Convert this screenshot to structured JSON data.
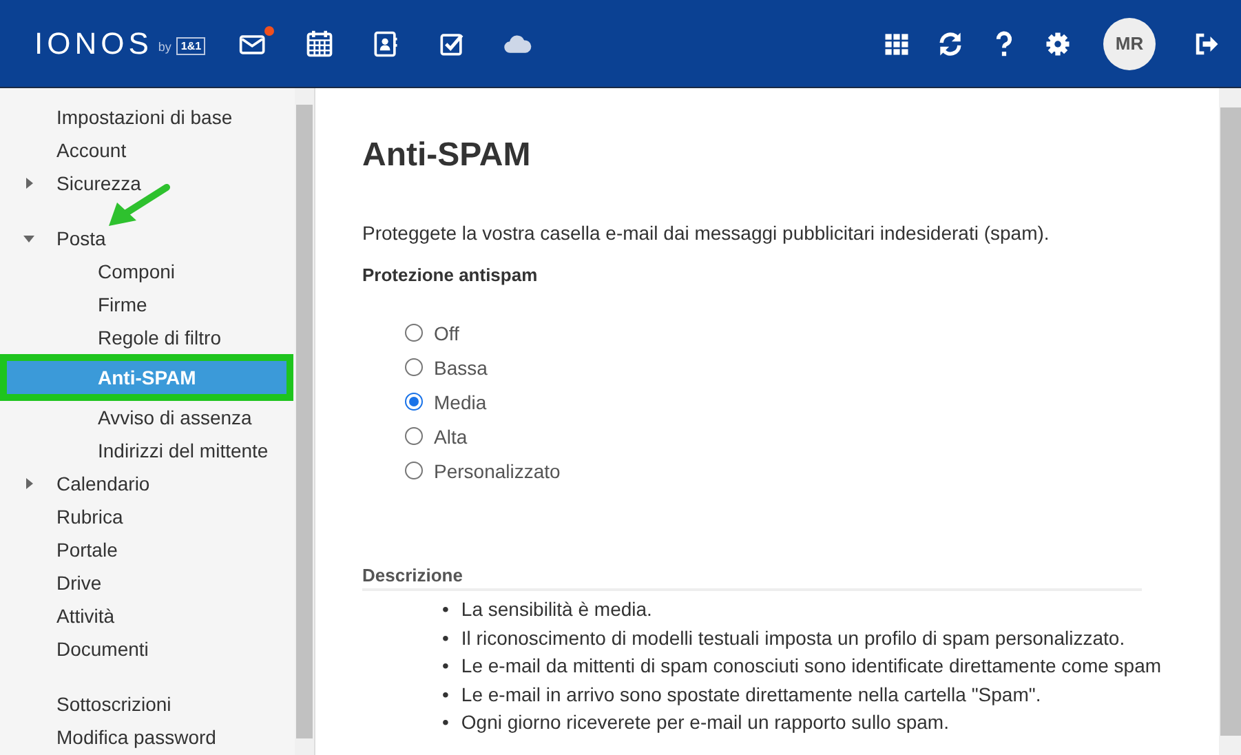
{
  "header": {
    "logo": "IONOS",
    "logo_by": "by",
    "logo_brand": "1&1",
    "apps": [
      {
        "kind": "mail",
        "badge": true
      },
      {
        "kind": "calendar",
        "badge": false
      },
      {
        "kind": "contacts",
        "badge": false
      },
      {
        "kind": "tasks",
        "badge": false
      },
      {
        "kind": "cloud",
        "badge": false
      }
    ],
    "tools": [
      {
        "kind": "apps"
      },
      {
        "kind": "refresh"
      },
      {
        "kind": "help"
      },
      {
        "kind": "settings"
      }
    ],
    "avatar": "MR"
  },
  "sidebar": {
    "pointer_arrow": true,
    "groups": [
      {
        "items": [
          {
            "label": "Impostazioni di base",
            "selected": false,
            "highlighted": false
          },
          {
            "label": "Account",
            "selected": false,
            "highlighted": false
          },
          {
            "label": "Sicurezza",
            "selected": false,
            "highlighted": false,
            "expanded": false
          }
        ]
      },
      {
        "items": [
          {
            "label": "Posta",
            "selected": false,
            "highlighted": false,
            "expanded": true,
            "children": [
              {
                "label": "Componi",
                "selected": false,
                "highlighted": false
              },
              {
                "label": "Firme",
                "selected": false,
                "highlighted": false
              },
              {
                "label": "Regole di filtro",
                "selected": false,
                "highlighted": false
              },
              {
                "label": "Anti-SPAM",
                "selected": true,
                "highlighted": true
              },
              {
                "label": "Avviso di assenza",
                "selected": false,
                "highlighted": false
              },
              {
                "label": "Indirizzi del mittente",
                "selected": false,
                "highlighted": false
              }
            ]
          },
          {
            "label": "Calendario",
            "selected": false,
            "highlighted": false,
            "expanded": false
          },
          {
            "label": "Rubrica",
            "selected": false,
            "highlighted": false
          },
          {
            "label": "Portale",
            "selected": false,
            "highlighted": false
          },
          {
            "label": "Drive",
            "selected": false,
            "highlighted": false
          },
          {
            "label": "Attività",
            "selected": false,
            "highlighted": false
          },
          {
            "label": "Documenti",
            "selected": false,
            "highlighted": false
          }
        ]
      },
      {
        "items": [
          {
            "label": "Sottoscrizioni",
            "selected": false,
            "highlighted": false
          },
          {
            "label": "Modifica password",
            "selected": false,
            "highlighted": false
          }
        ]
      }
    ]
  },
  "main": {
    "title": "Anti-SPAM",
    "intro": "Proteggete la vostra casella e-mail dai messaggi pubblicitari indesiderati (spam).",
    "protection_label": "Protezione antispam",
    "options": [
      {
        "label": "Off",
        "selected": false
      },
      {
        "label": "Bassa",
        "selected": false
      },
      {
        "label": "Media",
        "selected": true
      },
      {
        "label": "Alta",
        "selected": false
      },
      {
        "label": "Personalizzato",
        "selected": false
      }
    ],
    "description_heading": "Descrizione",
    "description": [
      {
        "bullet": "•",
        "text": "La sensibilità è media."
      },
      {
        "bullet": "•",
        "text": "Il riconoscimento di modelli testuali imposta un profilo di spam personalizzato."
      },
      {
        "bullet": "•",
        "text": "Le e-mail da mittenti di spam conosciuti sono identificate direttamente come spam"
      },
      {
        "bullet": "•",
        "text": "Le e-mail in arrivo sono spostate direttamente nella cartella \"Spam\"."
      },
      {
        "bullet": "•",
        "text": "Ogni giorno riceverete per e-mail un rapporto sullo spam."
      }
    ]
  }
}
